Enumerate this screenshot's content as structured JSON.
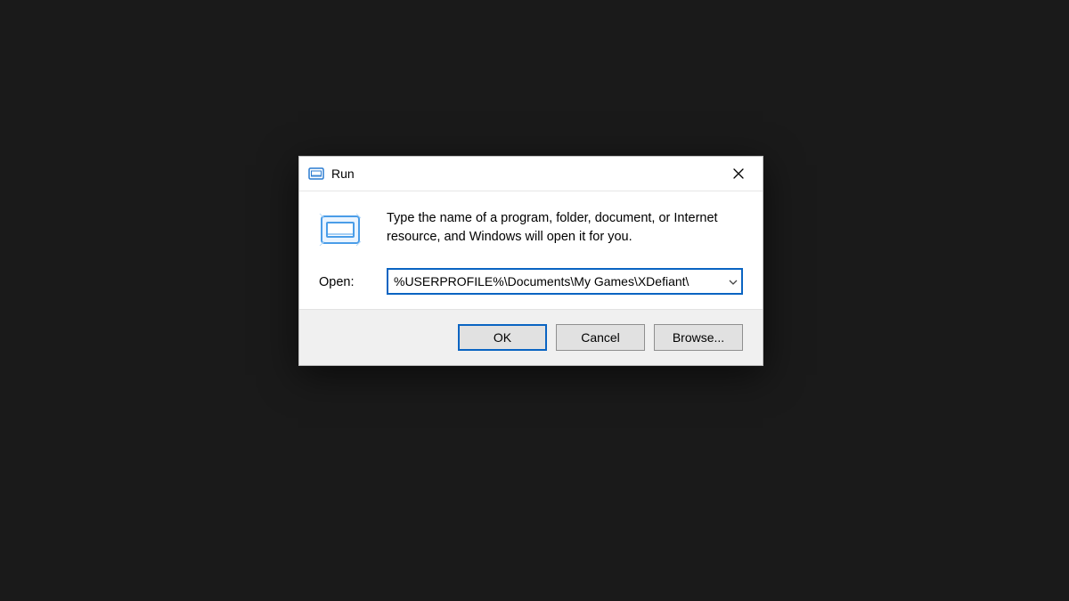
{
  "dialog": {
    "title": "Run",
    "description": "Type the name of a program, folder, document, or Internet resource, and Windows will open it for you.",
    "open_label": "Open:",
    "open_value": "%USERPROFILE%\\Documents\\My Games\\XDefiant\\",
    "buttons": {
      "ok": "OK",
      "cancel": "Cancel",
      "browse": "Browse..."
    }
  }
}
